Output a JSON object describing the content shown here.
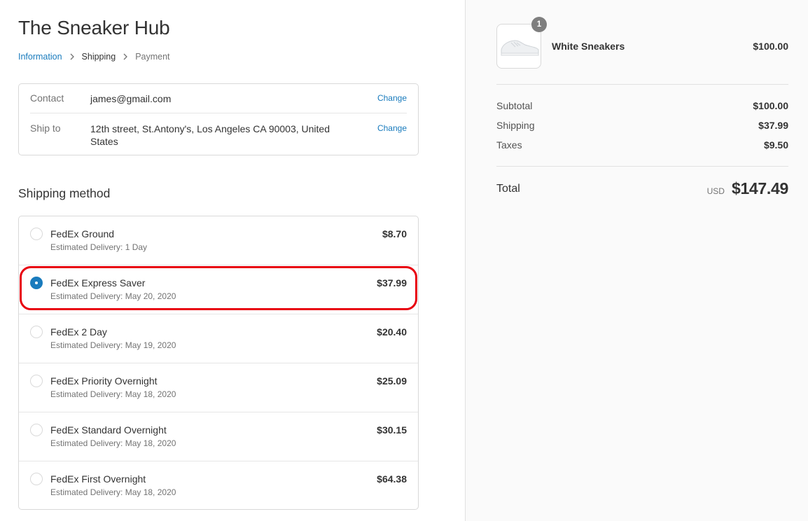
{
  "store": {
    "title": "The Sneaker Hub"
  },
  "breadcrumb": [
    {
      "label": "Information"
    },
    {
      "label": "Shipping"
    },
    {
      "label": "Payment"
    }
  ],
  "review": {
    "contact": {
      "label": "Contact",
      "value": "james@gmail.com",
      "action": "Change"
    },
    "ship_to": {
      "label": "Ship to",
      "value": "12th street, St.Antony's, Los Angeles CA 90003, United States",
      "action": "Change"
    }
  },
  "shipping": {
    "title": "Shipping method",
    "selected": "FedEx Express Saver",
    "methods": [
      {
        "name": "FedEx Ground",
        "eta": "Estimated Delivery: 1 Day",
        "price": "$8.70"
      },
      {
        "name": "FedEx Express Saver",
        "eta": "Estimated Delivery: May 20, 2020",
        "price": "$37.99"
      },
      {
        "name": "FedEx 2 Day",
        "eta": "Estimated Delivery: May 19, 2020",
        "price": "$20.40"
      },
      {
        "name": "FedEx Priority Overnight",
        "eta": "Estimated Delivery: May 18, 2020",
        "price": "$25.09"
      },
      {
        "name": "FedEx Standard Overnight",
        "eta": "Estimated Delivery: May 18, 2020",
        "price": "$30.15"
      },
      {
        "name": "FedEx First Overnight",
        "eta": "Estimated Delivery: May 18, 2020",
        "price": "$64.38"
      }
    ]
  },
  "summary": {
    "product": {
      "name": "White Sneakers",
      "price": "$100.00",
      "quantity": "1"
    },
    "subtotal": {
      "label": "Subtotal",
      "value": "$100.00"
    },
    "shipping": {
      "label": "Shipping",
      "value": "$37.99"
    },
    "taxes": {
      "label": "Taxes",
      "value": "$9.50"
    },
    "total": {
      "label": "Total",
      "currency": "USD",
      "value": "$147.49"
    }
  },
  "colors": {
    "accent": "#197bbd",
    "highlight": "#e8000f",
    "sidebar_bg": "#fafafa"
  }
}
